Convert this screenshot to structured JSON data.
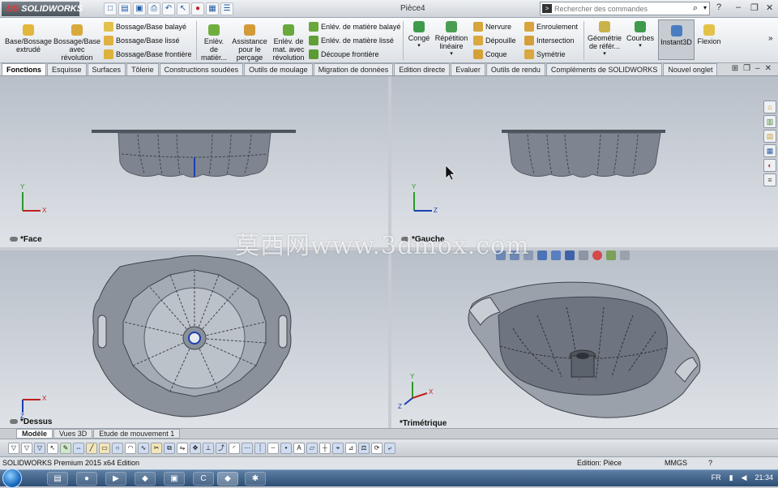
{
  "app": {
    "logo_text": "SOLIDWORKS",
    "document_title": "Pièce4"
  },
  "search": {
    "placeholder": "Rechercher des commandes"
  },
  "ribbon": {
    "large_buttons": [
      {
        "label": "Base/Bossage extrudé"
      },
      {
        "label": "Bossage/Base avec révolution"
      },
      {
        "label": "Enlèv. de matièr..."
      },
      {
        "label": "Assistance pour le perçage"
      },
      {
        "label": "Enlèv. de mat. avec révolution"
      },
      {
        "label": "Congé"
      },
      {
        "label": "Répétition linéaire"
      },
      {
        "label": "Géométrie de référ..."
      },
      {
        "label": "Courbes"
      },
      {
        "label": "Instant3D"
      },
      {
        "label": "Flexion"
      }
    ],
    "small_items": [
      {
        "label": "Bossage/Base balayé"
      },
      {
        "label": "Bossage/Base lissé"
      },
      {
        "label": "Bossage/Base frontière"
      },
      {
        "label": "Enlév. de matière balayé"
      },
      {
        "label": "Enlév. de matière lissé"
      },
      {
        "label": "Découpe frontière"
      },
      {
        "label": "Nervure"
      },
      {
        "label": "Dépouille"
      },
      {
        "label": "Coque"
      },
      {
        "label": "Enroulement"
      },
      {
        "label": "Intersection"
      },
      {
        "label": "Symétrie"
      }
    ]
  },
  "tabs": [
    {
      "label": "Fonctions"
    },
    {
      "label": "Esquisse"
    },
    {
      "label": "Surfaces"
    },
    {
      "label": "Tôlerie"
    },
    {
      "label": "Constructions soudées"
    },
    {
      "label": "Outils de moulage"
    },
    {
      "label": "Migration de données"
    },
    {
      "label": "Edition directe"
    },
    {
      "label": "Evaluer"
    },
    {
      "label": "Outils de rendu"
    },
    {
      "label": "Compléments de SOLIDWORKS"
    },
    {
      "label": "Nouvel onglet"
    }
  ],
  "viewports": [
    {
      "label": "*Face",
      "axis_h": "X",
      "axis_v": "Y"
    },
    {
      "label": "*Gauche",
      "axis_h": "Z",
      "axis_v": "Y"
    },
    {
      "label": "*Dessus",
      "axis_h": "X",
      "axis_v": "Z"
    },
    {
      "label": "*Trimétrique",
      "axis_h": "X",
      "axis_v": "Y",
      "axis_d": "Z"
    }
  ],
  "watermark": "莫西网www.3dmox.com",
  "bottom_tabs": [
    {
      "label": "Modèle"
    },
    {
      "label": "Vues 3D"
    },
    {
      "label": "Etude de mouvement 1"
    }
  ],
  "status": {
    "edition": "SOLIDWORKS Premium 2015 x64 Edition",
    "mode": "Edition: Pièce",
    "units": "MMGS",
    "help": "?"
  },
  "taskbar": {
    "lang": "FR",
    "clock": "21:34"
  },
  "colors": {
    "part_fill": "#7e8590",
    "part_dark": "#4e545c",
    "accent": "#1d5aa8"
  }
}
